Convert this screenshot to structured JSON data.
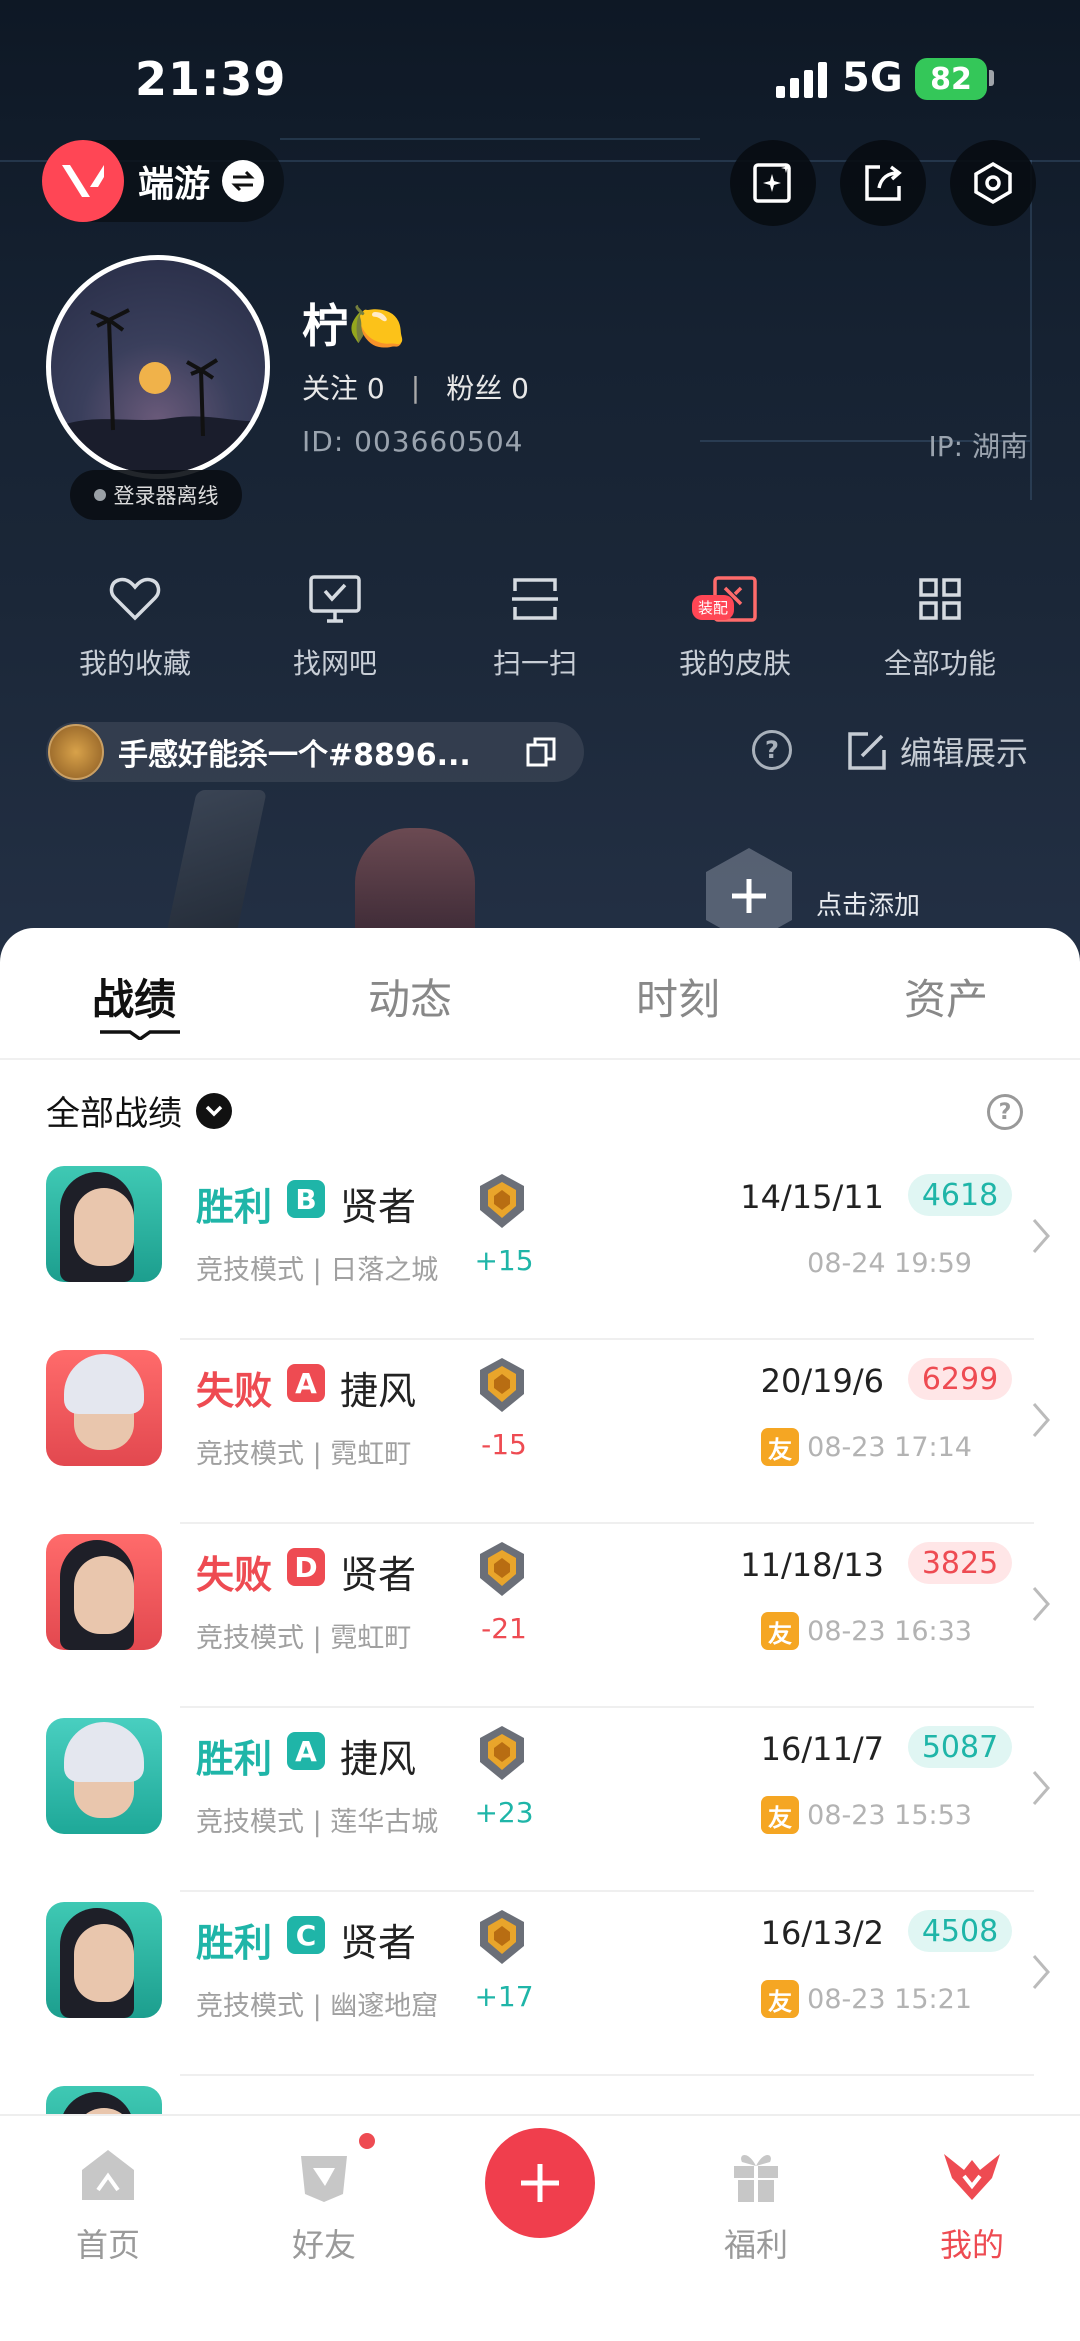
{
  "status": {
    "time": "21:39",
    "network": "5G",
    "battery": "82"
  },
  "header": {
    "game_name": "端游"
  },
  "profile": {
    "nickname": "柠🍋",
    "following_label": "关注",
    "following_count": "0",
    "followers_label": "粉丝",
    "followers_count": "0",
    "user_id": "ID: 003660504",
    "ip": "IP: 湖南",
    "online_status": "登录器离线"
  },
  "quick_actions": [
    {
      "label": "我的收藏",
      "icon": "heart-icon"
    },
    {
      "label": "找网吧",
      "icon": "monitor-icon"
    },
    {
      "label": "扫一扫",
      "icon": "scan-icon"
    },
    {
      "label": "我的皮肤",
      "icon": "skin-icon",
      "tag": "装配"
    },
    {
      "label": "全部功能",
      "icon": "grid-icon"
    }
  ],
  "pinned": {
    "text": "手感好能杀一个#8896...",
    "edit_label": "编辑展示",
    "add_label": "点击添加"
  },
  "tabs": [
    "战绩",
    "动态",
    "时刻",
    "资产"
  ],
  "filter": {
    "label": "全部战绩"
  },
  "matches": [
    {
      "result": "胜利",
      "outcome": "win",
      "grade": "B",
      "agent": "贤者",
      "mode": "竞技模式 | 日落之城",
      "rr": "+15",
      "kda": "14/15/11",
      "score": "4618",
      "date": "08-24 19:59",
      "friend": ""
    },
    {
      "result": "失败",
      "outcome": "lose",
      "grade": "A",
      "agent": "捷风",
      "mode": "竞技模式 | 霓虹町",
      "rr": "-15",
      "kda": "20/19/6",
      "score": "6299",
      "date": "08-23 17:14",
      "friend": "友"
    },
    {
      "result": "失败",
      "outcome": "lose",
      "grade": "D",
      "agent": "贤者",
      "mode": "竞技模式 | 霓虹町",
      "rr": "-21",
      "kda": "11/18/13",
      "score": "3825",
      "date": "08-23 16:33",
      "friend": "友"
    },
    {
      "result": "胜利",
      "outcome": "win",
      "grade": "A",
      "agent": "捷风",
      "mode": "竞技模式 | 莲华古城",
      "rr": "+23",
      "kda": "16/11/7",
      "score": "5087",
      "date": "08-23 15:53",
      "friend": "友"
    },
    {
      "result": "胜利",
      "outcome": "win",
      "grade": "C",
      "agent": "贤者",
      "mode": "竞技模式 | 幽邃地窟",
      "rr": "+17",
      "kda": "16/13/2",
      "score": "4508",
      "date": "08-23 15:21",
      "friend": "友"
    }
  ],
  "bottom_nav": [
    {
      "label": "首页",
      "icon": "home-icon"
    },
    {
      "label": "好友",
      "icon": "friends-icon"
    },
    {
      "label": "",
      "icon": "plus-icon"
    },
    {
      "label": "福利",
      "icon": "gift-icon"
    },
    {
      "label": "我的",
      "icon": "profile-icon"
    }
  ],
  "colors": {
    "accent": "#ee4b52",
    "win": "#1fb5a8",
    "friend": "#f5a623"
  }
}
